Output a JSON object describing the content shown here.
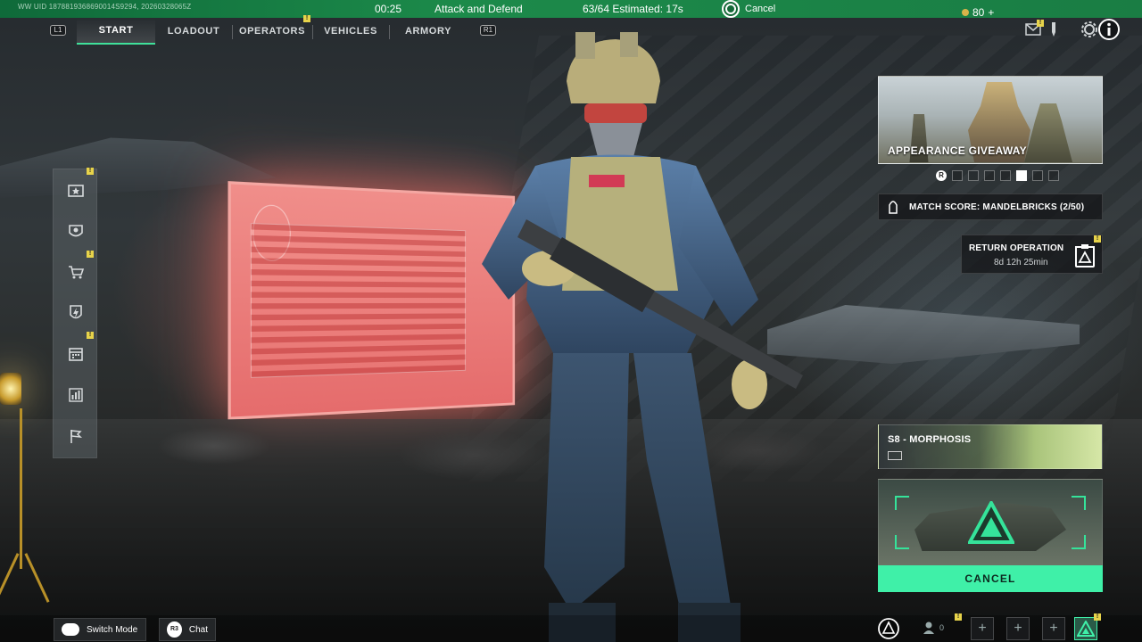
{
  "matchmaking": {
    "uid": "WW UID 1878819368690014S9294, 20260328065Z",
    "timer": "00:25",
    "mode": "Attack and Defend",
    "count": "63/64",
    "estimated": "Estimated: 17s",
    "cancel_label": "Cancel"
  },
  "nav": {
    "left_shoulder": "L1",
    "right_shoulder": "R1",
    "tabs": [
      "START",
      "LOADOUT",
      "OPERATORS",
      "VEHICLES",
      "ARMORY"
    ],
    "active_tab": "START"
  },
  "header": {
    "currency": "80",
    "currency_plus": "+"
  },
  "promo": {
    "title": "APPEARANCE GIVEAWAY",
    "page_count": 7,
    "active_page": 4,
    "r_button": "R"
  },
  "match_score": {
    "label": "MATCH SCORE: MANDELBRICKS (2/50)"
  },
  "return_operation": {
    "title": "RETURN OPERATION",
    "timer": "8d 12h 25min"
  },
  "season": {
    "title": "S8 - MORPHOSIS"
  },
  "queue": {
    "cancel_label": "CANCEL"
  },
  "bottom": {
    "switch_mode": "Switch Mode",
    "chat_button": "R3",
    "chat_label": "Chat",
    "friends_count": "0",
    "slot_icon": "+"
  },
  "colors": {
    "accent": "#3ff0a8",
    "matchmaking_bar": "#1c8a4a",
    "notification": "#e7d34a"
  }
}
